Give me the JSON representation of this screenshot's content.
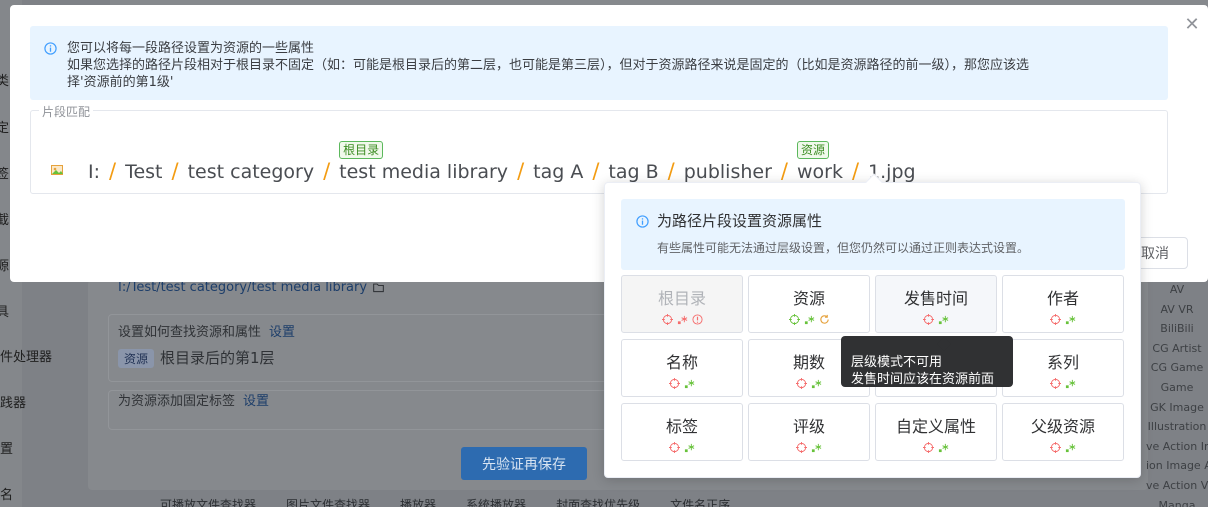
{
  "background": {
    "nav_items": [
      "类",
      "定",
      "签",
      "截",
      "源",
      "具",
      "件处理器",
      "践器",
      "置",
      "名"
    ],
    "path": "I:/Test/test category/test media library",
    "cards": [
      {
        "label": "设置如何查找资源和属性",
        "link": "设置"
      },
      {
        "label": "为资源添加固定标签",
        "link": "设置"
      }
    ],
    "resource_badge": "资源",
    "resource_rule": "根目录后的第1层",
    "main_button": "先验证再保存",
    "bottom_row": [
      "可播放文件查找器",
      "图片文件查找器",
      "播放器",
      "系统播放器",
      "封面查找优先级",
      "文件名正序"
    ],
    "right_list": [
      "AV",
      "AV VR",
      "BiliBili",
      "CG Artist",
      "CG Game",
      "Game",
      "GK Image",
      "Illustration",
      "ve Action Imag",
      "ion Image An",
      "ve Action Vide",
      "Manga"
    ]
  },
  "dialog": {
    "info_line1": "您可以将每一段路径设置为资源的一些属性",
    "info_line2": "如果您选择的路径片段相对于根目录不固定（如：可能是根目录后的第二层，也可能是第三层），但对于资源路径来说是固定的（比如是资源路径的前一级），那您应该选",
    "info_line3": "择'资源前的第1级'",
    "segment_legend": "片段匹配",
    "segments": [
      {
        "text": "I:",
        "tag": ""
      },
      {
        "text": "Test",
        "tag": ""
      },
      {
        "text": "test category",
        "tag": ""
      },
      {
        "text": "test media library",
        "tag": "根目录"
      },
      {
        "text": "tag A",
        "tag": ""
      },
      {
        "text": "tag B",
        "tag": ""
      },
      {
        "text": "publisher",
        "tag": ""
      },
      {
        "text": "work",
        "tag": "资源"
      },
      {
        "text": "1.jpg",
        "tag": ""
      }
    ],
    "separator": "/",
    "cancel_label": "取消"
  },
  "popover": {
    "title": "为路径片段设置资源属性",
    "description": "有些属性可能无法通过层级设置，但您仍然可以通过正则表达式设置。",
    "options": [
      {
        "label": "根目录",
        "icons": [
          "target-icon",
          "regex-icon",
          "error-icon"
        ],
        "disabled": true
      },
      {
        "label": "资源",
        "icons": [
          "target-icon",
          "regex-icon",
          "refresh-icon"
        ],
        "disabled": false
      },
      {
        "label": "发售时间",
        "icons": [
          "target-icon",
          "regex-icon"
        ],
        "disabled": false
      },
      {
        "label": "作者",
        "icons": [
          "target-icon",
          "regex-icon"
        ],
        "disabled": false
      },
      {
        "label": "名称",
        "icons": [
          "target-icon",
          "regex-icon"
        ],
        "disabled": false
      },
      {
        "label": "期数",
        "icons": [
          "target-icon",
          "regex-icon"
        ],
        "disabled": false
      },
      {
        "label": "",
        "icons": [],
        "disabled": false
      },
      {
        "label": "系列",
        "icons": [
          "target-icon",
          "regex-icon"
        ],
        "disabled": false
      },
      {
        "label": "标签",
        "icons": [
          "target-icon",
          "regex-icon"
        ],
        "disabled": false
      },
      {
        "label": "评级",
        "icons": [
          "target-icon",
          "regex-icon"
        ],
        "disabled": false
      },
      {
        "label": "自定义属性",
        "icons": [
          "target-icon",
          "regex-icon"
        ],
        "disabled": false
      },
      {
        "label": "父级资源",
        "icons": [
          "target-icon",
          "regex-icon"
        ],
        "disabled": false
      }
    ]
  },
  "tooltip": {
    "line1": "层级模式不可用",
    "line2": "发售时间应该在资源前面"
  },
  "colors": {
    "primary": "#409eff",
    "info_bg": "#e8f4ff",
    "separator": "#f39c12",
    "tag_green": "#5cb85c",
    "icon_red": "#f56c6c",
    "icon_green": "#67c23a",
    "icon_orange": "#e6a23c"
  }
}
